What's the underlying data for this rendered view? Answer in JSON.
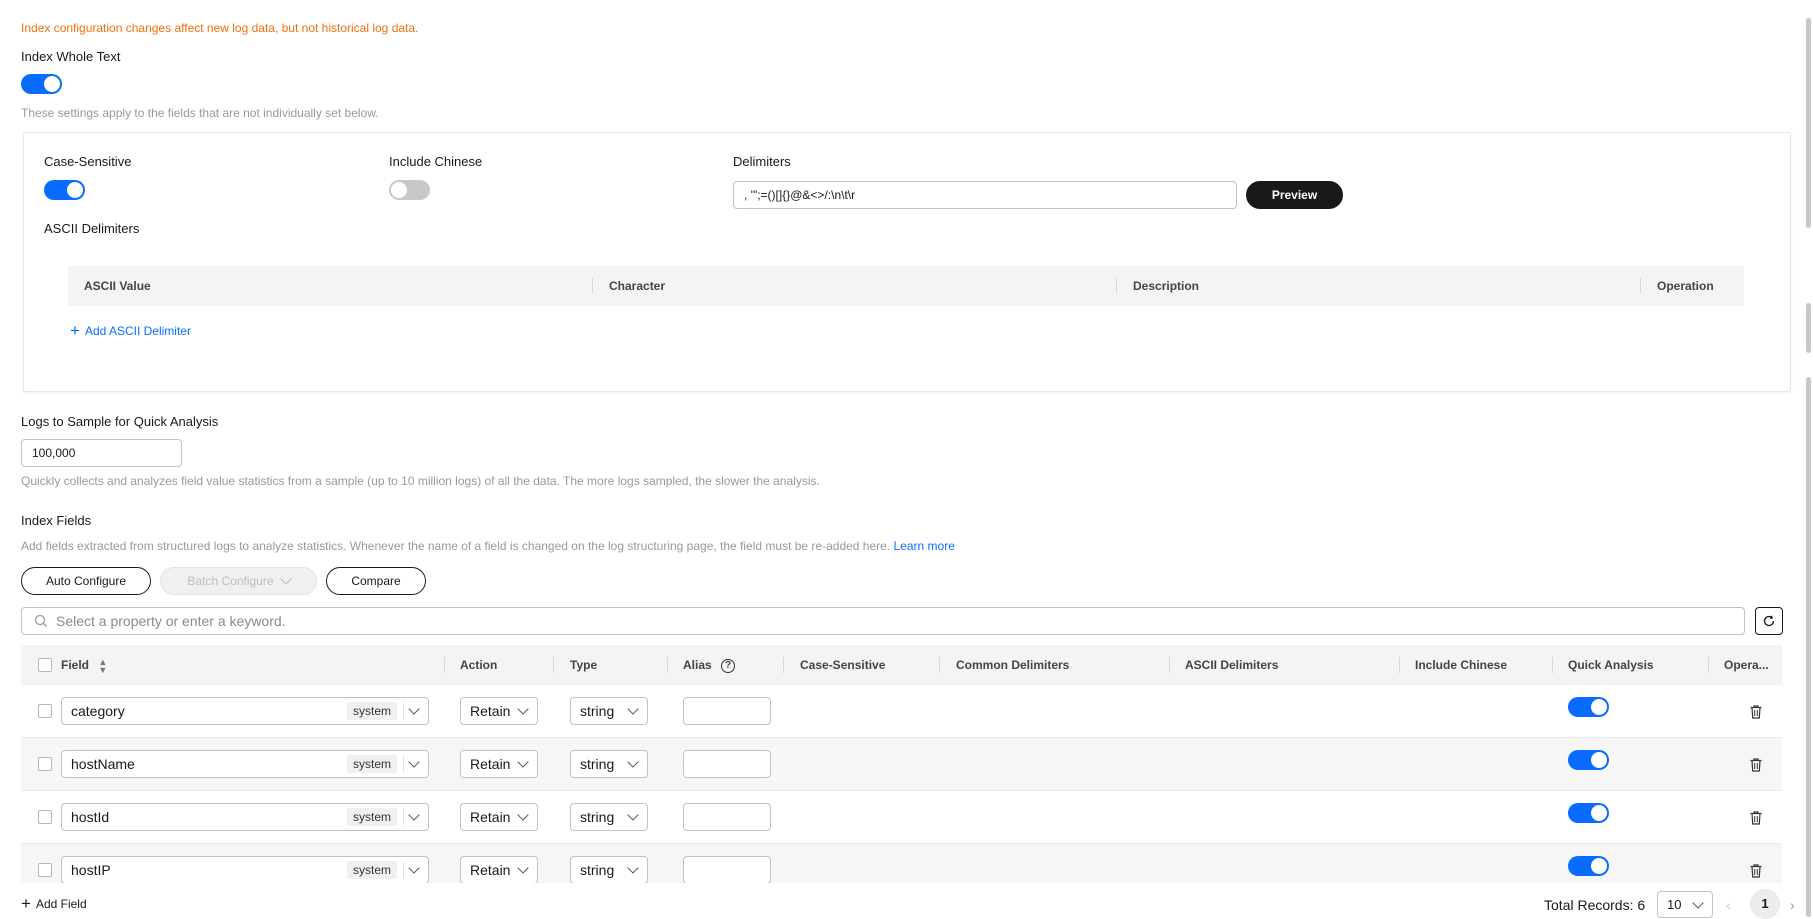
{
  "notice": "Index configuration changes affect new log data, but not historical log data.",
  "index_whole_text": {
    "label": "Index Whole Text",
    "enabled": true,
    "hint": "These settings apply to the fields that are not individually set below."
  },
  "settings": {
    "case_sensitive_label": "Case-Sensitive",
    "case_sensitive": true,
    "include_chinese_label": "Include Chinese",
    "include_chinese": false,
    "delimiters_label": "Delimiters",
    "delimiters_value": ", '\";=()[]{}@&<>/:\\n\\t\\r",
    "preview_label": "Preview",
    "ascii_delimiters_label": "ASCII Delimiters",
    "ascii_columns": [
      "ASCII Value",
      "Character",
      "Description",
      "Operation"
    ],
    "add_ascii_label": "Add ASCII Delimiter"
  },
  "sampling": {
    "label": "Logs to Sample for Quick Analysis",
    "value": "100,000",
    "hint": "Quickly collects and analyzes field value statistics from a sample (up to 10 million logs) of all the data. The more logs sampled, the slower the analysis."
  },
  "index_fields": {
    "label": "Index Fields",
    "hint": "Add fields extracted from structured logs to analyze statistics. Whenever the name of a field is changed on the log structuring page, the field must be re-added here.",
    "learn_more": "Learn more",
    "auto_configure": "Auto Configure",
    "batch_configure": "Batch Configure",
    "compare": "Compare",
    "search_placeholder": "Select a property or enter a keyword.",
    "columns": [
      "Field",
      "Action",
      "Type",
      "Alias",
      "Case-Sensitive",
      "Common Delimiters",
      "ASCII Delimiters",
      "Include Chinese",
      "Quick Analysis",
      "Opera..."
    ],
    "rows": [
      {
        "field": "category",
        "tag": "system",
        "action": "Retain",
        "type": "string",
        "alias": "",
        "quick_analysis": true
      },
      {
        "field": "hostName",
        "tag": "system",
        "action": "Retain",
        "type": "string",
        "alias": "",
        "quick_analysis": true
      },
      {
        "field": "hostId",
        "tag": "system",
        "action": "Retain",
        "type": "string",
        "alias": "",
        "quick_analysis": true
      },
      {
        "field": "hostIP",
        "tag": "system",
        "action": "Retain",
        "type": "string",
        "alias": "",
        "quick_analysis": true
      }
    ]
  },
  "footer": {
    "add_field": "Add Field",
    "total_records": "Total Records: 6",
    "page_size": "10",
    "current_page": "1"
  }
}
